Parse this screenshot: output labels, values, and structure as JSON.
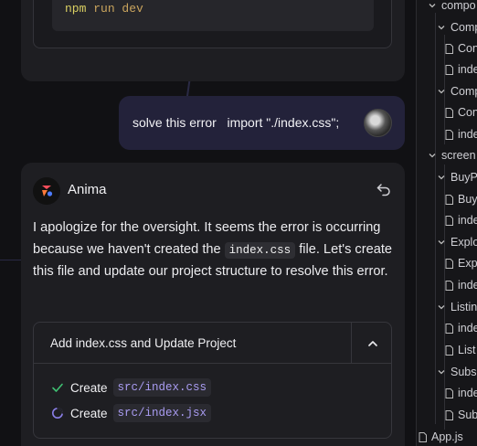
{
  "previous_message": {
    "code_command": "npm",
    "code_args": "run dev"
  },
  "user_message": {
    "text": "solve this error   import \"./index.css\";"
  },
  "assistant": {
    "name": "Anima",
    "paragraph": {
      "part1": "I apologize for the oversight. It seems the error is occurring because we haven't created the ",
      "code": "index.css",
      "part2": " file. Let's create this file and update our project structure to resolve this error."
    },
    "task": {
      "title": "Add index.css and Update Project",
      "steps": [
        {
          "verb": "Create",
          "path": "src/index.css",
          "status": "done",
          "icon": "check-icon"
        },
        {
          "verb": "Create",
          "path": "src/index.jsx",
          "status": "in-progress",
          "icon": "spinner-icon"
        }
      ]
    }
  },
  "file_tree": {
    "rows": [
      {
        "label": "compo",
        "kind": "folder",
        "expanded": true
      },
      {
        "label": "Comp",
        "kind": "folder",
        "expanded": true
      },
      {
        "label": "Con",
        "kind": "file"
      },
      {
        "label": "inde",
        "kind": "file"
      },
      {
        "label": "Comp",
        "kind": "folder",
        "expanded": true
      },
      {
        "label": "Con",
        "kind": "file"
      },
      {
        "label": "inde",
        "kind": "file"
      },
      {
        "label": "screen",
        "kind": "folder",
        "expanded": true
      },
      {
        "label": "BuyP",
        "kind": "folder",
        "expanded": true
      },
      {
        "label": "Buy",
        "kind": "file"
      },
      {
        "label": "inde",
        "kind": "file"
      },
      {
        "label": "Explo",
        "kind": "folder",
        "expanded": true
      },
      {
        "label": "Exp",
        "kind": "file"
      },
      {
        "label": "inde",
        "kind": "file"
      },
      {
        "label": "Listin",
        "kind": "folder",
        "expanded": true
      },
      {
        "label": "inde",
        "kind": "file"
      },
      {
        "label": "List",
        "kind": "file"
      },
      {
        "label": "Subs",
        "kind": "folder",
        "expanded": true
      },
      {
        "label": "inde",
        "kind": "file"
      },
      {
        "label": "Sub",
        "kind": "file"
      },
      {
        "label": "App.js",
        "kind": "file"
      }
    ]
  },
  "colors": {
    "accent_purple": "#a99cf2",
    "check_green": "#3fbf72",
    "user_bubble": "#23223a"
  }
}
